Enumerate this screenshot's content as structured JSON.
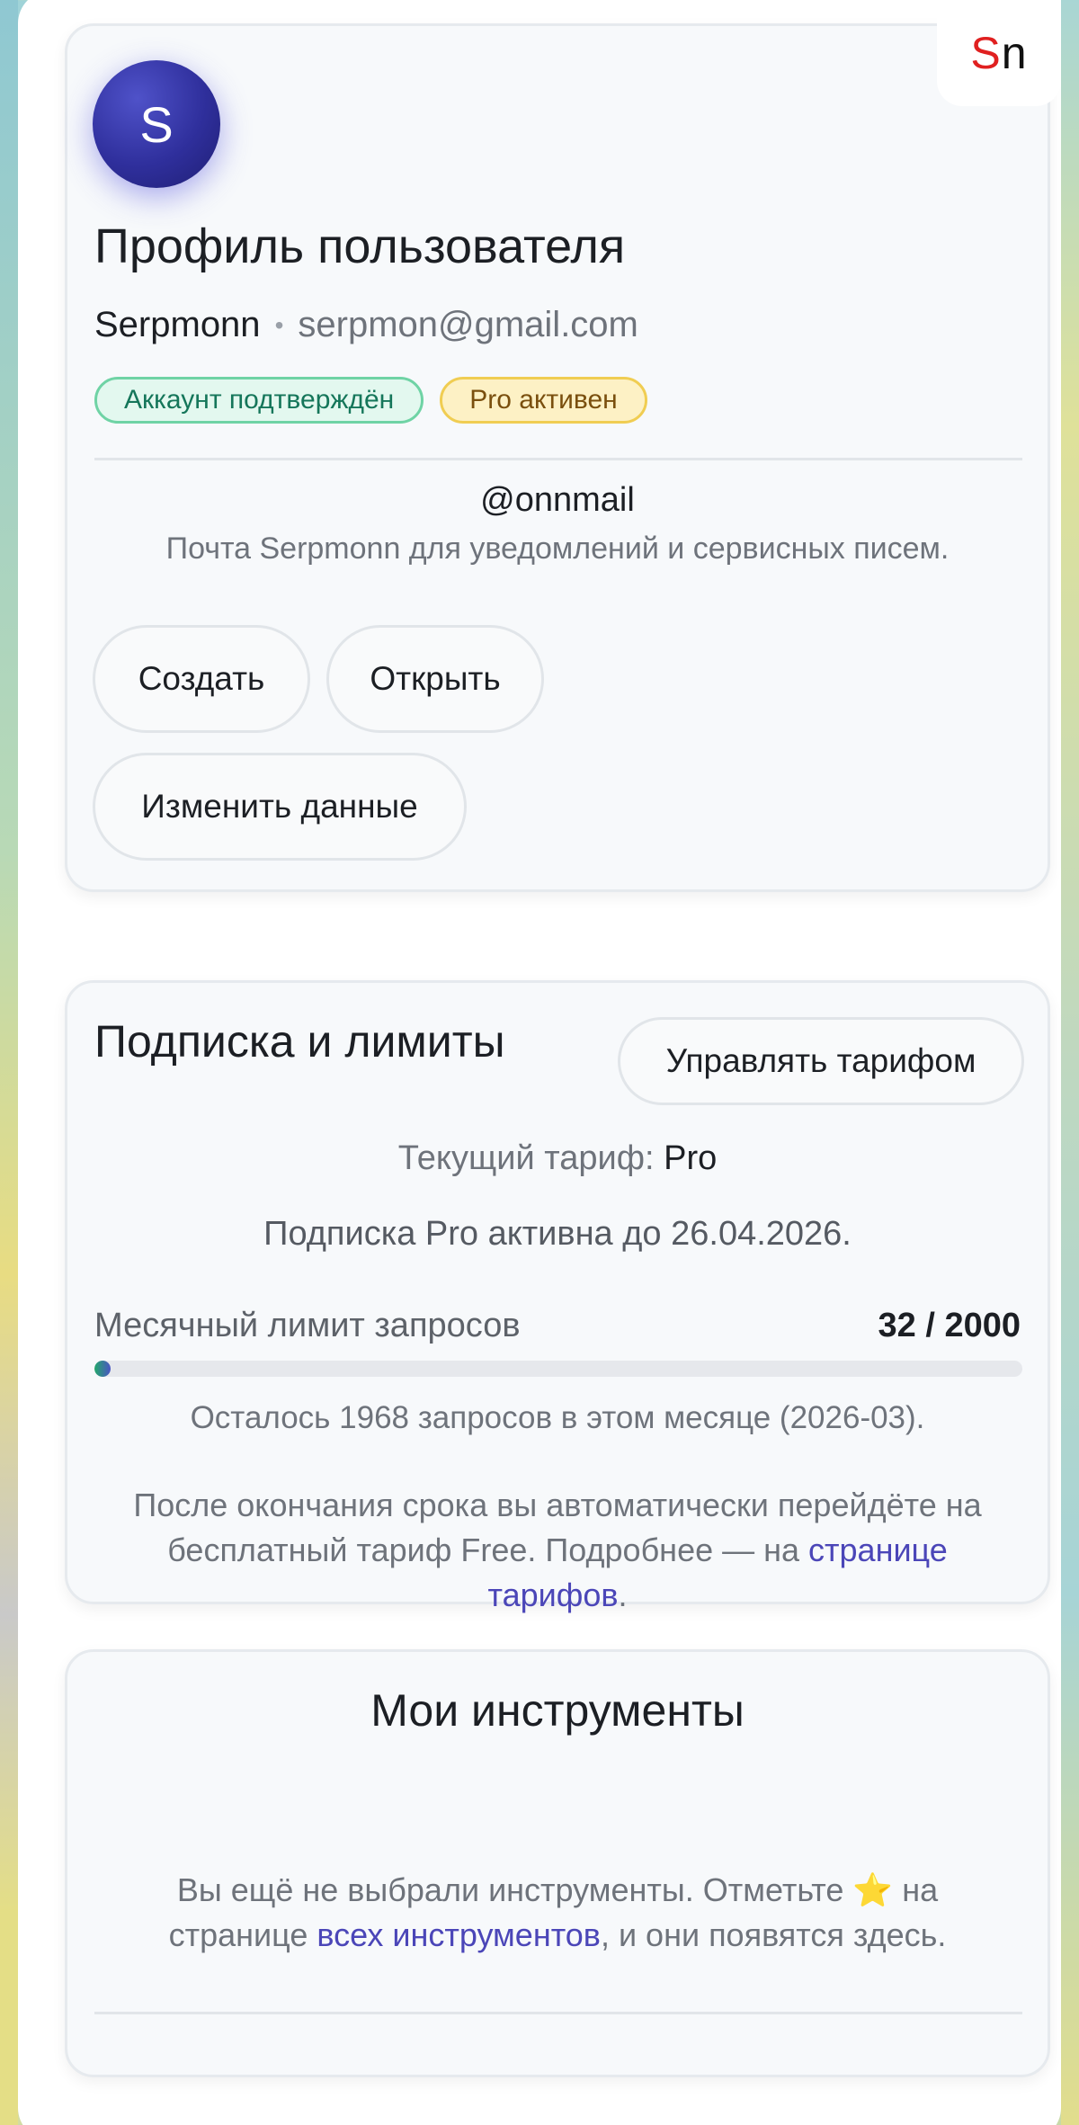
{
  "brand": {
    "logo_first": "S",
    "logo_second": "n",
    "accent": "#e02020"
  },
  "profile": {
    "avatar_letter": "S",
    "title": "Профиль пользователя",
    "username": "Serpmonn",
    "separator": "•",
    "email": "serpmon@gmail.com",
    "badges": {
      "verified": "Аккаунт подтверждён",
      "pro": "Pro активен"
    },
    "mail_handle": "@onnmail",
    "mail_description": "Почта Serpmonn для уведомлений и сервисных писем.",
    "buttons": {
      "create": "Создать",
      "open": "Открыть",
      "edit": "Изменить данные"
    }
  },
  "subscription": {
    "title": "Подписка и лимиты",
    "manage_button": "Управлять тарифом",
    "plan_label": "Текущий тариф:",
    "plan_value": "Pro",
    "active_until": "Подписка Pro активна до 26.04.2026.",
    "limit_label": "Месячный лимит запросов",
    "limit_value": "32 / 2000",
    "limit_used_fraction": 0.016,
    "remaining_text": "Осталось 1968 запросов в этом месяце (2026-03).",
    "after_text_before_link": "После окончания срока вы автоматически перейдёте на бесплатный тариф Free. Подробнее — на",
    "after_link": "странице тарифов",
    "after_text_end": "."
  },
  "tools": {
    "title": "Мои инструменты",
    "empty_text_before_star": "Вы ещё не выбрали инструменты. Отметьте",
    "star_glyph": "⭐",
    "empty_text_after_star": "на странице",
    "empty_link": "всех инструментов",
    "empty_text_end": ", и они появятся здесь."
  }
}
